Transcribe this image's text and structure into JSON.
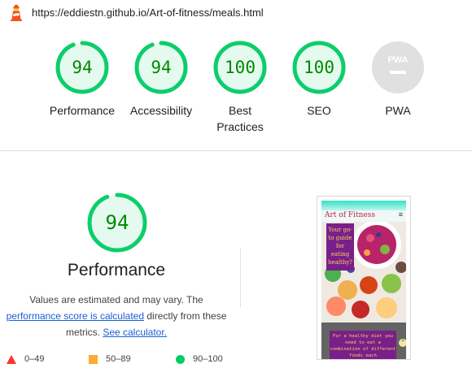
{
  "topbar": {
    "logo_icon": "lighthouse-icon",
    "url": "https://eddiestn.github.io/Art-of-fitness/meals.html"
  },
  "categories": [
    {
      "id": "performance",
      "score": "94",
      "value": 94,
      "label": "Performance"
    },
    {
      "id": "accessibility",
      "score": "94",
      "value": 94,
      "label": "Accessibility"
    },
    {
      "id": "best-practices",
      "score": "100",
      "value": 100,
      "label": "Best Practices"
    },
    {
      "id": "seo",
      "score": "100",
      "value": 100,
      "label": "SEO"
    },
    {
      "id": "pwa",
      "score": "",
      "value": null,
      "label": "PWA",
      "badge_text": "PWA"
    }
  ],
  "performance": {
    "score": "94",
    "value": 94,
    "title": "Performance",
    "desc_prefix": "Values are estimated and may vary. The",
    "link_score": "performance score is calculated",
    "desc_middle": "directly from these metrics.",
    "link_calculator": "See calculator."
  },
  "legend": [
    {
      "icon": "red-triangle-icon",
      "range": "0–49",
      "color": "#ff3333"
    },
    {
      "icon": "orange-square-icon",
      "range": "50–89",
      "color": "#ffaa33"
    },
    {
      "icon": "green-circle-icon",
      "range": "90–100",
      "color": "#00cc66"
    }
  ],
  "screenshot": {
    "brand": "Art of Fitness",
    "menu_glyph": "≡",
    "tagline": "Your go-to guide for eating healthy?",
    "promo": "For a healthy diet you need to eat a combination of different foods each"
  },
  "colors": {
    "pass_green": "#0cce6b",
    "pass_text": "#008800",
    "pass_bg": "#e5faef",
    "pwa_grey": "#e0e0e0"
  }
}
